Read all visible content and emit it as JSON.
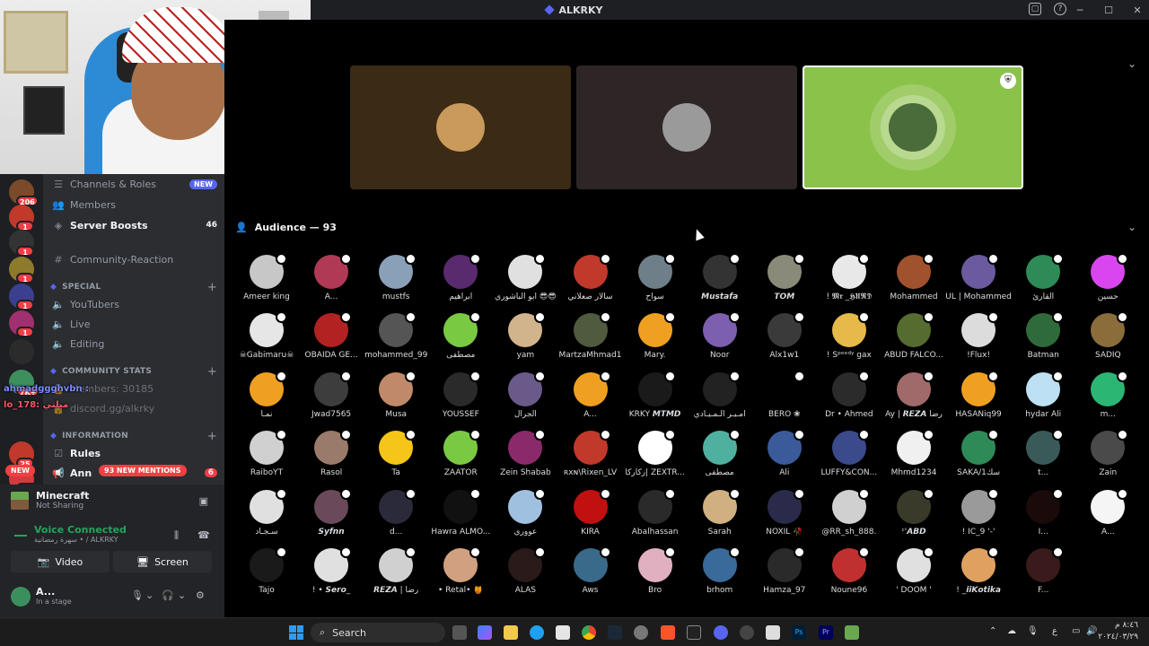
{
  "window": {
    "title": "ALKRKY",
    "help": "?",
    "minimize": "─",
    "maximize": "☐",
    "close": "✕"
  },
  "servers": [
    {
      "color": "#7b4a2a",
      "badge": "206"
    },
    {
      "color": "#c0392b",
      "badge": "1"
    },
    {
      "color": "#333333",
      "badge": "1"
    },
    {
      "color": "#8e7a2b",
      "badge": "1"
    },
    {
      "color": "#3b3f8f",
      "badge": "1"
    },
    {
      "color": "#a03070",
      "badge": "1"
    },
    {
      "color": "#2b2b2b",
      "badge": ""
    },
    {
      "color": "#3e8f5e",
      "badge": "7K+"
    },
    {
      "color": "#c0392b",
      "badge": "25"
    },
    {
      "color": "#d23b3b",
      "badge": "181"
    }
  ],
  "channels": {
    "channels_roles": {
      "label": "Channels & Roles",
      "badge": "NEW"
    },
    "members": {
      "label": "Members"
    },
    "server_boosts": {
      "label": "Server Boosts",
      "count": "46"
    },
    "community_reaction": {
      "label": "Community-Reaction"
    },
    "special_cat": {
      "label": "SPECIAL",
      "plus": "+"
    },
    "youtubers": {
      "label": "YouTubers"
    },
    "live": {
      "label": "Live"
    },
    "editing": {
      "label": "Editing"
    },
    "stats_cat": {
      "label": "COMMUNITY STATS",
      "plus": "+"
    },
    "members_count": {
      "label": "Members: 30185"
    },
    "discord_link": {
      "label": "discord.gg/alkrky"
    },
    "info_cat": {
      "label": "INFORMATION",
      "plus": "+"
    },
    "rules": {
      "label": "Rules"
    },
    "announcements": {
      "label": "Ann",
      "count": "6"
    },
    "mentions_pill": "93 NEW MENTIONS",
    "new_badge": "NEW"
  },
  "chat_overlay": [
    {
      "text": "ahmadggghvbn :",
      "color": "#7b8cff"
    },
    {
      "text": "lo_178: ميلتي",
      "color": "#ff5566"
    }
  ],
  "voice_panel": {
    "activity_title": "Minecraft",
    "activity_sub": "Not Sharing",
    "connected": "Voice Connected",
    "connected_sub": "سهرة رمضانية • / ALKRKY",
    "video_label": "Video",
    "screen_label": "Screen",
    "user_name": "A...",
    "user_status": "In a stage"
  },
  "stage": {
    "tiles": [
      {
        "bg": "#3b2a14",
        "avatar": "#c99a5b"
      },
      {
        "bg": "#2e2626",
        "avatar": "#9a9a9a"
      },
      {
        "bg": "#8bc34a",
        "avatar": "#4a6b3a"
      }
    ],
    "audience_label": "Audience — 93",
    "shield": "⛨"
  },
  "audience": [
    {
      "name": "Ameer king",
      "color": "#c7c7c7"
    },
    {
      "name": "A...",
      "color": "#b03a55"
    },
    {
      "name": "mustfs",
      "color": "#8aa0b8"
    },
    {
      "name": "ابراهيم",
      "color": "#5a2a6e"
    },
    {
      "name": "ابو الباشوري 😎😎",
      "color": "#e0e0e0"
    },
    {
      "name": "سالار صعلاني",
      "color": "#c0392b"
    },
    {
      "name": "سواح",
      "color": "#6f7f8a"
    },
    {
      "name": "𝙈𝙪𝙨𝙩𝙖𝙛𝙖",
      "color": "#333333"
    },
    {
      "name": "𝙏𝙊𝙈",
      "color": "#8a8a7a"
    },
    {
      "name": "! 𝕸𝖗 _𝕳𝖀𝕽𝕯",
      "color": "#e8e8e8"
    },
    {
      "name": "Mohammed",
      "color": "#a0522d"
    },
    {
      "name": "UL | Mohammed",
      "color": "#6b5a9e"
    },
    {
      "name": "القارئ",
      "color": "#2e8b57"
    },
    {
      "name": "حسين",
      "color": "#d946ef"
    },
    {
      "name": "☠Gabimaru☠",
      "color": "#e6e6e6"
    },
    {
      "name": "OBAIDA GE...",
      "color": "#b22222"
    },
    {
      "name": "mohammed_99",
      "color": "#555555"
    },
    {
      "name": "مصطفى",
      "color": "#7ac943"
    },
    {
      "name": "yam",
      "color": "#d2b48c"
    },
    {
      "name": "MartzaMhmad1",
      "color": "#4f5a3e"
    },
    {
      "name": "Mary.",
      "color": "#f0a020"
    },
    {
      "name": "Noor",
      "color": "#7d5fb0"
    },
    {
      "name": "Alx1w1",
      "color": "#3a3a3a"
    },
    {
      "name": "! Sᵖᵉᵉᵈʸ gax",
      "color": "#e5b94a"
    },
    {
      "name": "ABUD FALCO...",
      "color": "#556b2f"
    },
    {
      "name": "!Flux!",
      "color": "#dcdcdc"
    },
    {
      "name": "Batman",
      "color": "#2f6b3a"
    },
    {
      "name": "SADIQ",
      "color": "#8a6d3b"
    },
    {
      "name": "نمـا",
      "color": "#f0a020"
    },
    {
      "name": "Jwad7565",
      "color": "#3d3d3d"
    },
    {
      "name": "Musa",
      "color": "#c08a6a"
    },
    {
      "name": "YOUSSEF",
      "color": "#2a2a2a"
    },
    {
      "name": "الجرال",
      "color": "#6a5a8a"
    },
    {
      "name": "A...",
      "color": "#f0a020"
    },
    {
      "name": "KRKY 𝙈𝙏𝙈𝘿",
      "color": "#1a1a1a"
    },
    {
      "name": "أمـيـر الـمـيـادي",
      "color": "#222222"
    },
    {
      "name": "BERO ❀",
      "color": "#000000"
    },
    {
      "name": "Dr • Ahmed",
      "color": "#2b2b2b"
    },
    {
      "name": "Ay | 𝙍𝙀𝙕𝘼 رضا",
      "color": "#a06a6a"
    },
    {
      "name": "HASANiq99",
      "color": "#f0a020"
    },
    {
      "name": "hydar Ali",
      "color": "#bde0f5"
    },
    {
      "name": "m...",
      "color": "#2bb673"
    },
    {
      "name": "RaiboYT",
      "color": "#d0d0d0"
    },
    {
      "name": "Rasol",
      "color": "#9a7a6a"
    },
    {
      "name": "Ta",
      "color": "#f5c518"
    },
    {
      "name": "ZAATOR",
      "color": "#7ac943"
    },
    {
      "name": "Zein Shabab",
      "color": "#8a2a6a"
    },
    {
      "name": "ʀxɴ\\Rixen_LV",
      "color": "#c0392b"
    },
    {
      "name": "زكاركا| ZEXTR...",
      "color": "#ffffff"
    },
    {
      "name": "مصطفى",
      "color": "#4fb0a0"
    },
    {
      "name": "Ali",
      "color": "#3a5a9a"
    },
    {
      "name": "LUFFY&CON...",
      "color": "#3a4a8a"
    },
    {
      "name": "Mhmd1234",
      "color": "#f0f0f0"
    },
    {
      "name": "SAKA/1سك",
      "color": "#2e8b57"
    },
    {
      "name": "t...",
      "color": "#3a5a5a"
    },
    {
      "name": "Zain",
      "color": "#4a4a4a"
    },
    {
      "name": "سـجـاد",
      "color": "#e0e0e0"
    },
    {
      "name": "𝙎𝙮𝙛𝙣𝙣",
      "color": "#6a4a5a"
    },
    {
      "name": "d...",
      "color": "#2a2a3a"
    },
    {
      "name": "Hawra ALMO...",
      "color": "#111111"
    },
    {
      "name": "عووري",
      "color": "#a0c0e0"
    },
    {
      "name": "KIRA",
      "color": "#c01010"
    },
    {
      "name": "Abalhassan",
      "color": "#2a2a2a"
    },
    {
      "name": "Sarah",
      "color": "#d0b080"
    },
    {
      "name": "NOXIL 🥀",
      "color": "#2a2a4a"
    },
    {
      "name": "@RR_sh_888.",
      "color": "#d0d0d0"
    },
    {
      "name": "ᶜ'𝘼𝘽𝘿",
      "color": "#3a3a2a"
    },
    {
      "name": "! IC_9 '-'",
      "color": "#9a9a9a"
    },
    {
      "name": "I...",
      "color": "#1a0a0a"
    },
    {
      "name": "A...",
      "color": "#f5f5f5"
    },
    {
      "name": "Tajo",
      "color": "#1a1a1a"
    },
    {
      "name": "! • 𝙎𝙚𝙧𝙤_",
      "color": "#e0e0e0"
    },
    {
      "name": "𝙍𝙀𝙕𝘼 | رضا",
      "color": "#d0d0d0"
    },
    {
      "name": "• Retal• 🍯",
      "color": "#d0a080"
    },
    {
      "name": "ALAS",
      "color": "#2a1a1a"
    },
    {
      "name": "Aws",
      "color": "#3a6a8a"
    },
    {
      "name": "Bro",
      "color": "#e0b0c0"
    },
    {
      "name": "brhom",
      "color": "#3a6a9a"
    },
    {
      "name": "Hamza_97",
      "color": "#2a2a2a"
    },
    {
      "name": "Noune96",
      "color": "#c03030"
    },
    {
      "name": "' DOOM '",
      "color": "#e0e0e0"
    },
    {
      "name": "! _𝙞𝙞𝙆𝙤𝙩𝙞𝙠𝙖",
      "color": "#e0a060"
    },
    {
      "name": "F...",
      "color": "#3a1a1a"
    }
  ],
  "taskbar": {
    "search_placeholder": "Search",
    "tray_lang": "ع",
    "time": "٨:٤٦ م",
    "date": "٢٠٢٤/٠٣/٢٩"
  }
}
